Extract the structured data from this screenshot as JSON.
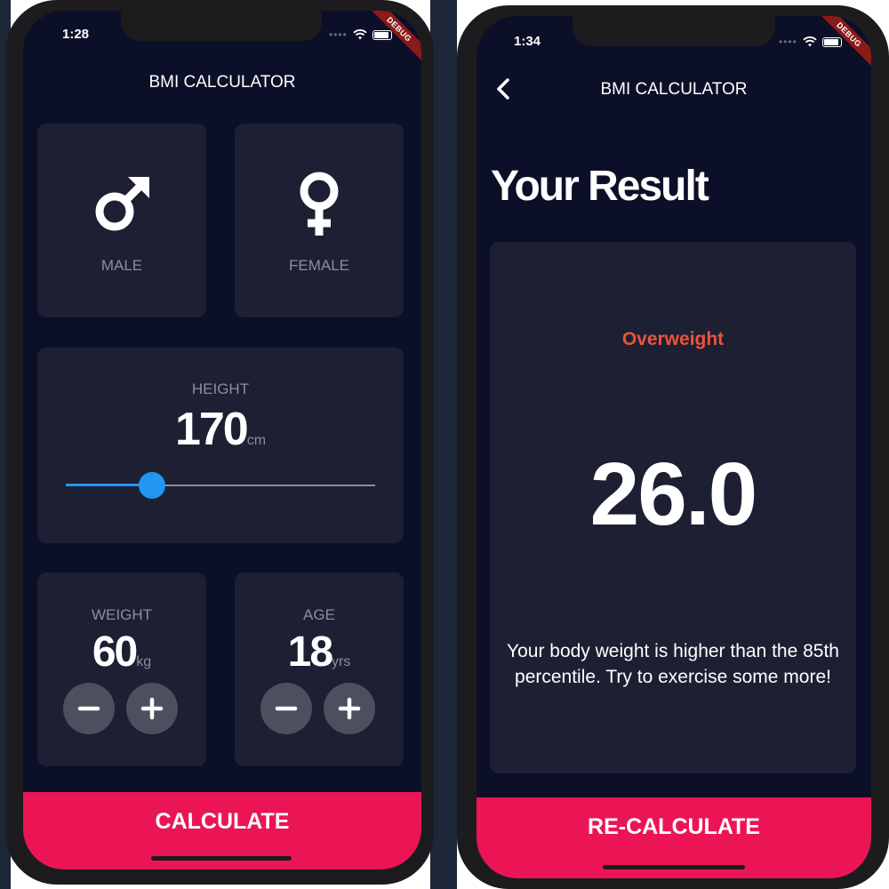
{
  "left_screen": {
    "status": {
      "time": "1:28",
      "debug_badge": "DEBUG"
    },
    "title": "BMI CALCULATOR",
    "gender": {
      "male": {
        "icon": "male-symbol-icon",
        "label": "MALE"
      },
      "female": {
        "icon": "female-symbol-icon",
        "label": "FEMALE"
      }
    },
    "height": {
      "label": "HEIGHT",
      "value": "170",
      "unit": "cm",
      "slider_fraction": 0.28
    },
    "weight": {
      "label": "WEIGHT",
      "value": "60",
      "unit": "kg"
    },
    "age": {
      "label": "AGE",
      "value": "18",
      "unit": "yrs"
    },
    "calculate_label": "CALCULATE"
  },
  "right_screen": {
    "status": {
      "time": "1:34",
      "debug_badge": "DEBUG"
    },
    "title": "BMI CALCULATOR",
    "heading": "Your Result",
    "result_category": "Overweight",
    "bmi_value": "26.0",
    "interpretation": "Your body weight is higher than the 85th percentile. Try to exercise some more!",
    "recalculate_label": "RE-CALCULATE"
  },
  "colors": {
    "background": "#0b1028",
    "card": "#1d1f33",
    "accent_pink": "#eb1555",
    "slider_active": "#2196f3",
    "overweight_red": "#e8553b",
    "label_grey": "#8d8e98"
  }
}
